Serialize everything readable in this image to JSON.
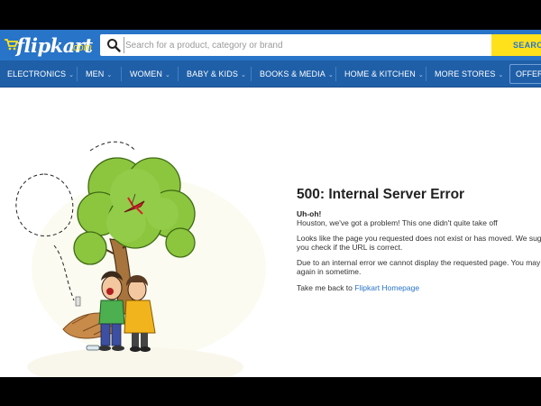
{
  "header": {
    "logo_text": "flipkart",
    "logo_tld": ".com",
    "search_placeholder": "Search for a product, category or brand",
    "search_button": "SEARCH",
    "brand_color": "#2874c8",
    "accent_color": "#ffe11b"
  },
  "nav": {
    "items": [
      {
        "label": "ELECTRONICS"
      },
      {
        "label": "MEN"
      },
      {
        "label": "WOMEN"
      },
      {
        "label": "BABY & KIDS"
      },
      {
        "label": "BOOKS & MEDIA"
      },
      {
        "label": "HOME & KITCHEN"
      },
      {
        "label": "MORE STORES"
      }
    ],
    "offers": "OFFERS"
  },
  "error": {
    "title": "500: Internal Server Error",
    "uh_oh": "Uh-oh!",
    "houston": "Houston, we've got a problem! This one didn't quite take off",
    "moved_line1": "Looks like the page you requested does not exist or has moved. We sug",
    "moved_line2": "you check if the URL is correct.",
    "internal_line1": "Due to an internal error we cannot display the requested page. You may",
    "internal_line2": "again in sometime.",
    "back_prefix": "Take me back to ",
    "back_link": "Flipkart Homepage"
  }
}
